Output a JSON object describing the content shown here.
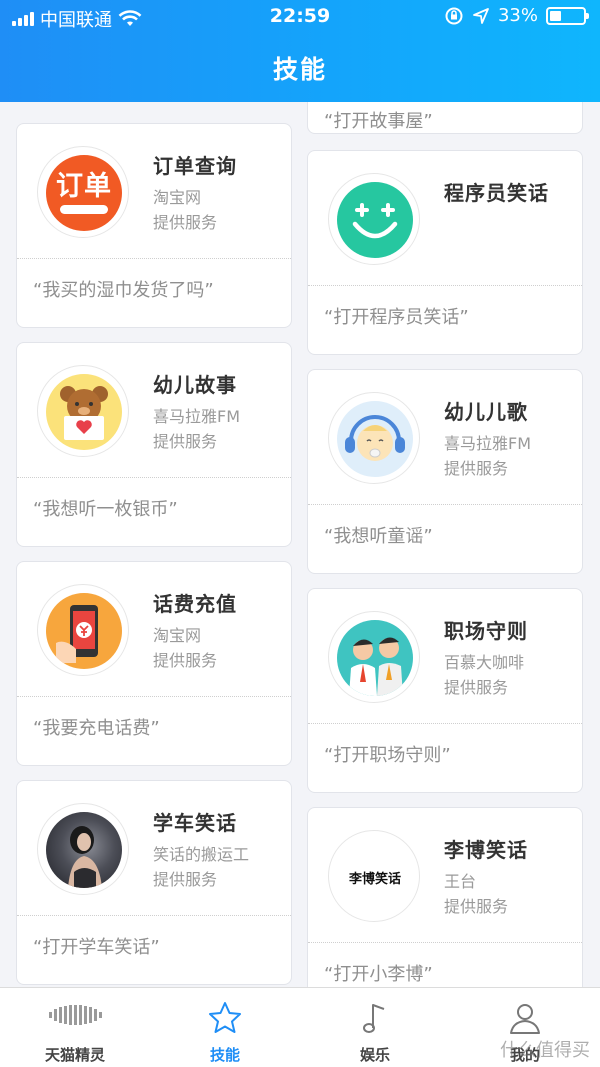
{
  "status_bar": {
    "carrier": "中国联通",
    "time": "22:59",
    "battery": "33%",
    "battery_level": 0.33
  },
  "header": {
    "title": "技能"
  },
  "top_partial": {
    "phrase": "“打开故事屋”"
  },
  "skills_left": [
    {
      "name": "订单查询",
      "provider": "淘宝网",
      "service": "提供服务",
      "phrase": "“我买的湿巾发货了吗”",
      "icon": "order-query-icon",
      "badge_text": "订单"
    },
    {
      "name": "幼儿故事",
      "provider": "喜马拉雅FM",
      "service": "提供服务",
      "phrase": "“我想听一枚银币”",
      "icon": "bear-story-icon"
    },
    {
      "name": "话费充值",
      "provider": "淘宝网",
      "service": "提供服务",
      "phrase": "“我要充电话费”",
      "icon": "phone-recharge-icon"
    },
    {
      "name": "学车笑话",
      "provider": "笑话的搬运工",
      "service": "提供服务",
      "phrase": "“打开学车笑话”",
      "icon": "driving-joke-photo"
    }
  ],
  "skills_right": [
    {
      "name": "程序员笑话",
      "provider": "",
      "service": "",
      "phrase": "“打开程序员笑话”",
      "icon": "smiley-icon"
    },
    {
      "name": "幼儿儿歌",
      "provider": "喜马拉雅FM",
      "service": "提供服务",
      "phrase": "“我想听童谣”",
      "icon": "baby-song-icon"
    },
    {
      "name": "职场守则",
      "provider": "百慕大咖啡",
      "service": "提供服务",
      "phrase": "“打开职场守则”",
      "icon": "workplace-icon"
    },
    {
      "name": "李博笑话",
      "provider": "王台",
      "service": "提供服务",
      "phrase": "“打开小李博”",
      "icon": "libo-joke-icon",
      "badge_text": "李博笑话"
    }
  ],
  "tabbar": {
    "tabs": [
      {
        "label": "天猫精灵",
        "icon": "speaker-icon",
        "active": false
      },
      {
        "label": "技能",
        "icon": "star-icon",
        "active": true
      },
      {
        "label": "娱乐",
        "icon": "music-note-icon",
        "active": false
      },
      {
        "label": "我的",
        "icon": "profile-icon",
        "active": false
      }
    ]
  },
  "watermark": "什么值得买",
  "colors": {
    "accent": "#1f8ef6",
    "header_start": "#1f8ef6",
    "header_end": "#0fb6fd",
    "order_red": "#f15a24",
    "smiley_green": "#26c7a0"
  }
}
